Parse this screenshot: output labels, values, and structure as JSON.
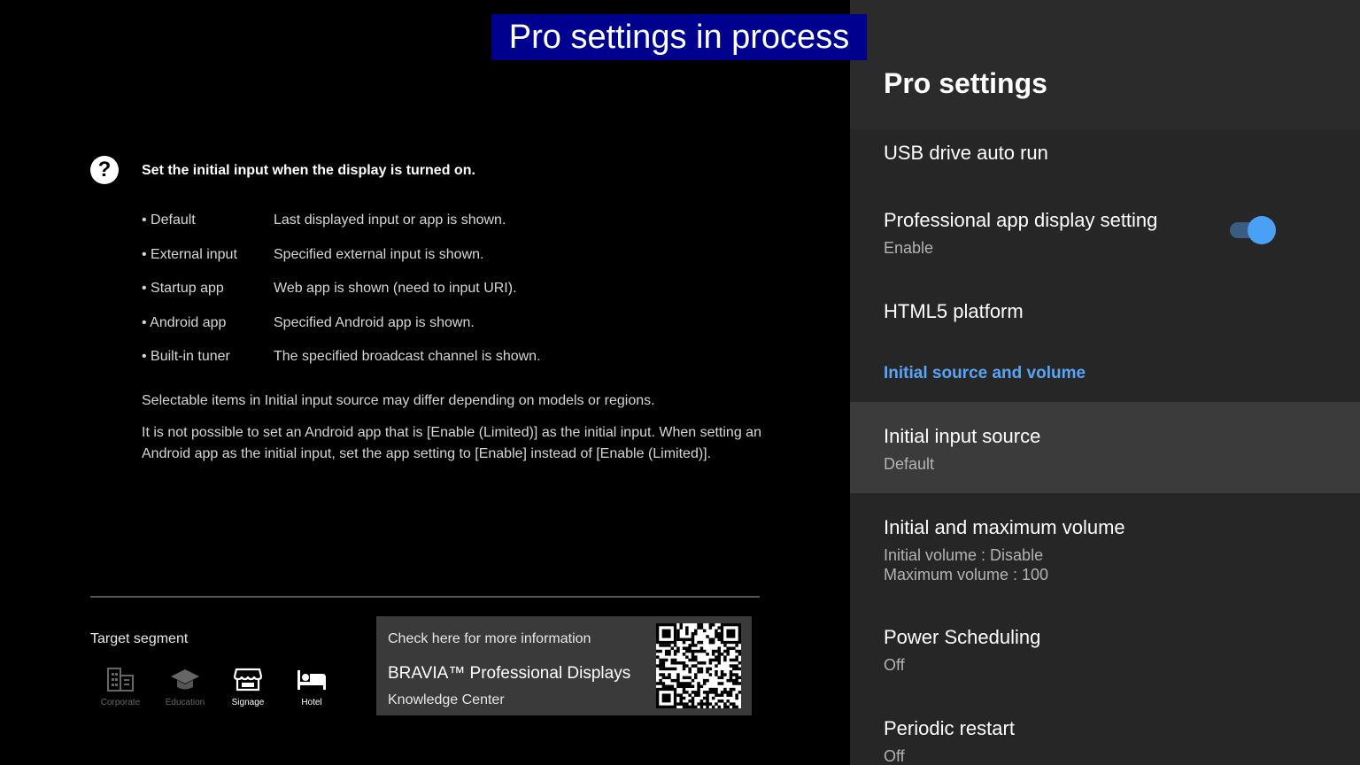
{
  "banner": "Pro settings in process",
  "help": {
    "icon": "help-circle-icon",
    "title": "Set the initial input when the display is turned on.",
    "options": [
      {
        "name": "• Default",
        "desc": "Last displayed input or app is shown."
      },
      {
        "name": "• External input",
        "desc": "Specified external input is shown."
      },
      {
        "name": "• Startup app",
        "desc": "Web app is shown (need to input URI)."
      },
      {
        "name": "• Android app",
        "desc": "Specified Android app is shown."
      },
      {
        "name": "• Built-in tuner",
        "desc": "The specified broadcast channel is shown."
      }
    ],
    "note1": "Selectable items in Initial input source may differ depending on models or regions.",
    "note2": "It is not possible to set an Android app that is [Enable (Limited)] as the initial input. When setting an Android app as the initial input, set the app setting to [Enable] instead of [Enable (Limited)]."
  },
  "target_segment": {
    "label": "Target segment",
    "items": [
      {
        "label": "Corporate",
        "icon": "building-icon",
        "active": false
      },
      {
        "label": "Education",
        "icon": "graduation-cap-icon",
        "active": false
      },
      {
        "label": "Signage",
        "icon": "storefront-icon",
        "active": true
      },
      {
        "label": "Hotel",
        "icon": "bed-icon",
        "active": true
      }
    ]
  },
  "info": {
    "top": "Check here for more information",
    "mid": "BRAVIA™ Professional Displays",
    "bot": "Knowledge Center",
    "qr_icon": "qr-code-icon"
  },
  "panel": {
    "title": "Pro settings",
    "items": [
      {
        "title": "USB drive auto run"
      },
      {
        "title": "Professional app display setting",
        "sub": "Enable",
        "toggle": true
      },
      {
        "title": "HTML5 platform"
      }
    ],
    "section": "Initial source and volume",
    "section_items": [
      {
        "title": "Initial input source",
        "sub": "Default",
        "focused": true
      },
      {
        "title": "Initial and maximum volume",
        "sub": "Initial volume : Disable",
        "sub2": "Maximum volume : 100"
      },
      {
        "title": "Power Scheduling",
        "sub": "Off"
      },
      {
        "title": "Periodic restart",
        "sub": "Off"
      }
    ]
  },
  "colors": {
    "banner_bg": "#00008f",
    "accent": "#4aa0f5",
    "section_head": "#5aa4f5",
    "panel_bg": "#262626",
    "focused_bg": "#3b3b3b"
  }
}
